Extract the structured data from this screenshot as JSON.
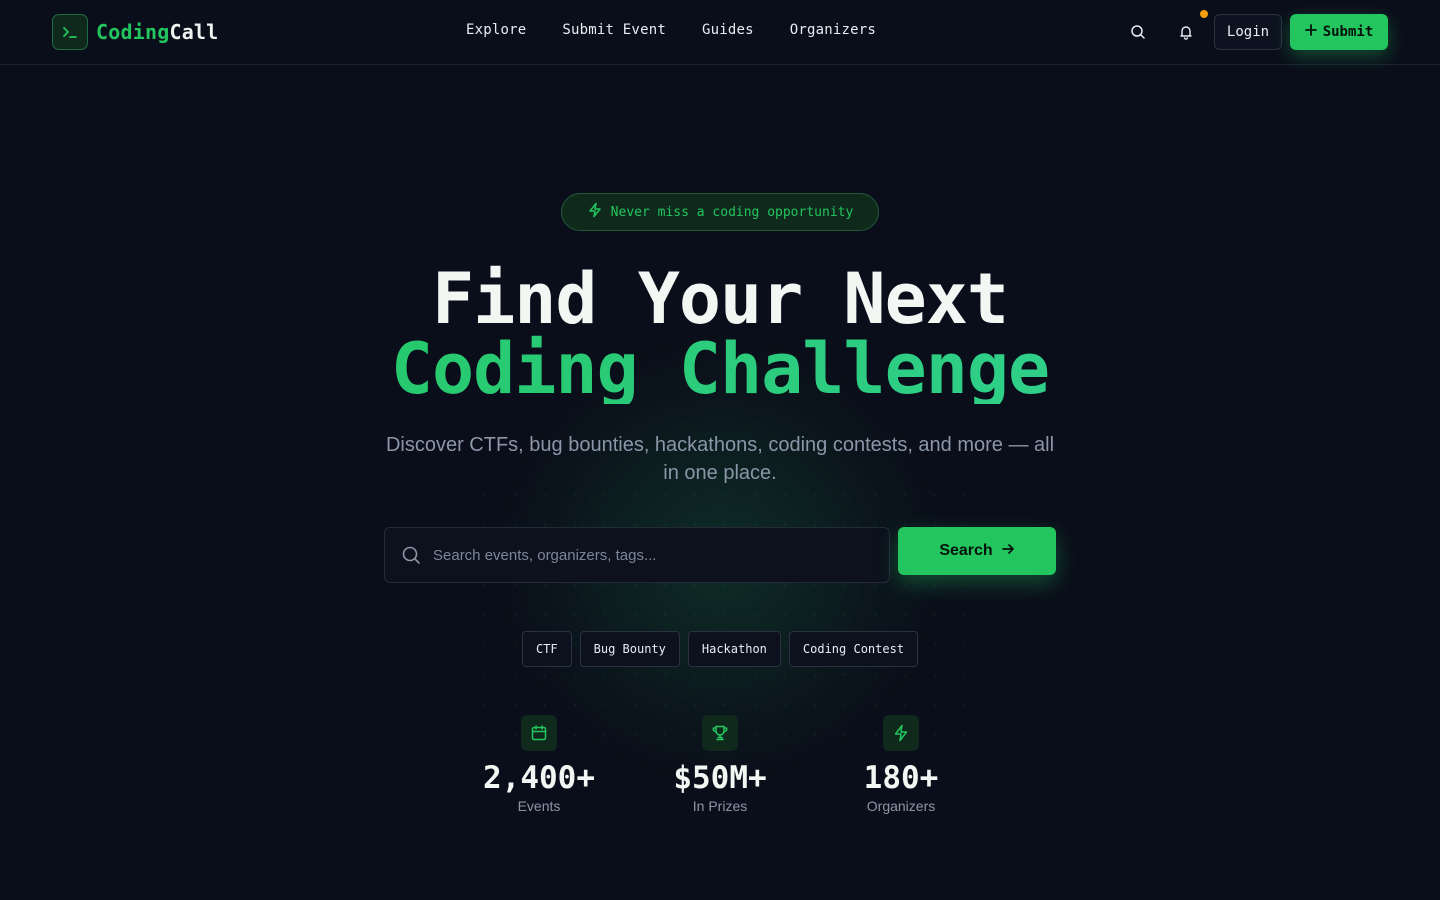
{
  "brand": {
    "name_part1": "Coding",
    "name_part2": "Call"
  },
  "nav": {
    "items": [
      {
        "label": "Explore"
      },
      {
        "label": "Submit Event"
      },
      {
        "label": "Guides"
      },
      {
        "label": "Organizers"
      }
    ]
  },
  "header_actions": {
    "search_icon": "search-icon",
    "notification_icon": "bell-icon",
    "notification_dot_color": "#f59e0b",
    "login_label": "Login",
    "submit_label": "Submit"
  },
  "hero": {
    "badge": "Never miss a coding opportunity",
    "title_line1": "Find Your Next",
    "title_line2": "Coding Challenge",
    "subtitle": "Discover CTFs, bug bounties, hackathons, coding contests, and more — all in one place."
  },
  "search": {
    "placeholder": "Search events, organizers, tags...",
    "value": "",
    "button_label": "Search"
  },
  "tags": [
    {
      "label": "CTF"
    },
    {
      "label": "Bug Bounty"
    },
    {
      "label": "Hackathon"
    },
    {
      "label": "Coding Contest"
    }
  ],
  "stats": [
    {
      "icon": "calendar-icon",
      "value": "2,400+",
      "label": "Events"
    },
    {
      "icon": "trophy-icon",
      "value": "$50M+",
      "label": "In Prizes"
    },
    {
      "icon": "bolt-icon",
      "value": "180+",
      "label": "Organizers"
    }
  ],
  "colors": {
    "accent": "#22c55e",
    "background": "#0a0e1a",
    "muted_text": "#8b96a8"
  }
}
